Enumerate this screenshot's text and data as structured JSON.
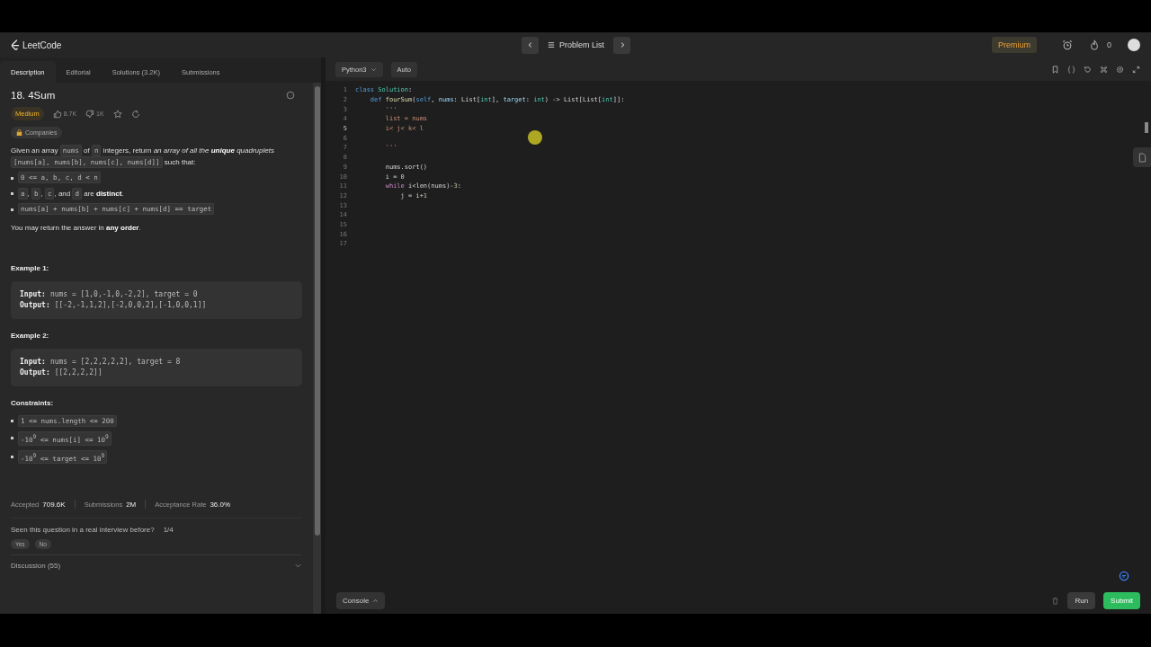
{
  "nav": {
    "logo": "LeetCode",
    "center": "Problem List",
    "premium": "Premium",
    "streak": "0"
  },
  "tabs": [
    {
      "label": "Description",
      "selected": true
    },
    {
      "label": "Editorial",
      "selected": false
    },
    {
      "label": "Solutions (3.2K)",
      "selected": false
    },
    {
      "label": "Submissions",
      "selected": false
    }
  ],
  "problem": {
    "title": "18. 4Sum",
    "difficulty": "Medium",
    "likes": "8.7K",
    "dislikes": "1K",
    "companies": "Companies",
    "intro": [
      {
        "kind": "text",
        "text": "Given an array "
      },
      {
        "kind": "code",
        "text": "nums"
      },
      {
        "kind": "text",
        "text": " of "
      },
      {
        "kind": "code",
        "text": "n"
      },
      {
        "kind": "text",
        "text": " integers, return "
      },
      {
        "kind": "italic",
        "text": "an array of all the "
      },
      {
        "kind": "bolditalic",
        "text": "unique"
      },
      {
        "kind": "italic",
        "text": " quadruplets "
      },
      {
        "kind": "code",
        "text": "[nums[a], nums[b], nums[c], nums[d]]"
      },
      {
        "kind": "text",
        "text": " such that:"
      }
    ],
    "bullets": [
      [
        {
          "kind": "code",
          "text": "0 <= a, b, c, d < n"
        }
      ],
      [
        {
          "kind": "code",
          "text": "a"
        },
        {
          "kind": "text",
          "text": ", "
        },
        {
          "kind": "code",
          "text": "b"
        },
        {
          "kind": "text",
          "text": ", "
        },
        {
          "kind": "code",
          "text": "c"
        },
        {
          "kind": "text",
          "text": ", and "
        },
        {
          "kind": "code",
          "text": "d"
        },
        {
          "kind": "text",
          "text": " are "
        },
        {
          "kind": "bold",
          "text": "distinct"
        },
        {
          "kind": "text",
          "text": "."
        }
      ],
      [
        {
          "kind": "code",
          "text": "nums[a] + nums[b] + nums[c] + nums[d] == target"
        }
      ]
    ],
    "closing": [
      {
        "kind": "text",
        "text": "You may return the answer in "
      },
      {
        "kind": "bold",
        "text": "any order"
      },
      {
        "kind": "text",
        "text": "."
      }
    ],
    "examples": [
      {
        "title": "Example 1:",
        "input_label": "Input:",
        "input": "nums = [1,0,-1,0,-2,2], target = 0",
        "output_label": "Output:",
        "output": "[[-2,-1,1,2],[-2,0,0,2],[-1,0,0,1]]"
      },
      {
        "title": "Example 2:",
        "input_label": "Input:",
        "input": "nums = [2,2,2,2,2], target = 8",
        "output_label": "Output:",
        "output": "[[2,2,2,2]]"
      }
    ],
    "constraints_title": "Constraints:",
    "constraints": [
      "1 <= nums.length <= 200",
      "-10$^{9}$ <= nums[i] <= 10$^{9}$",
      "-10$^{9}$ <= target <= 10$^{9}$"
    ],
    "stats": [
      {
        "label": "Accepted",
        "value": "709.6K"
      },
      {
        "label": "Submissions",
        "value": "2M"
      },
      {
        "label": "Acceptance Rate",
        "value": "36.0%"
      }
    ],
    "interview": {
      "question": "Seen this question in a real interview before?",
      "count": "1/4",
      "answers": [
        "Yes",
        "No"
      ]
    },
    "discussion": "Discussion (55)"
  },
  "editor": {
    "language": "Python3",
    "mode": "Auto",
    "console": "Console",
    "run": "Run",
    "submit": "Submit",
    "lines": [
      {
        "number": "1",
        "tokens": [
          {
            "kind": "keyword",
            "text": "class "
          },
          {
            "kind": "type",
            "text": "Solution"
          },
          {
            "kind": "plain",
            "text": ":"
          }
        ]
      },
      {
        "number": "2",
        "tokens": [
          {
            "kind": "keyword",
            "text": "    def "
          },
          {
            "kind": "func",
            "text": "fourSum"
          },
          {
            "kind": "plain",
            "text": "("
          },
          {
            "kind": "keyword",
            "text": "self"
          },
          {
            "kind": "plain",
            "text": ", "
          },
          {
            "kind": "param",
            "text": "nums"
          },
          {
            "kind": "plain",
            "text": ": List["
          },
          {
            "kind": "type",
            "text": "int"
          },
          {
            "kind": "plain",
            "text": "], "
          },
          {
            "kind": "param",
            "text": "target"
          },
          {
            "kind": "plain",
            "text": ": "
          },
          {
            "kind": "type",
            "text": "int"
          },
          {
            "kind": "plain",
            "text": ") -> List[List["
          },
          {
            "kind": "type",
            "text": "int"
          },
          {
            "kind": "plain",
            "text": "]]:"
          }
        ]
      },
      {
        "number": "3",
        "tokens": [
          {
            "kind": "string",
            "text": "        '''"
          }
        ]
      },
      {
        "number": "4",
        "tokens": [
          {
            "kind": "string",
            "text": "        list = nums"
          }
        ]
      },
      {
        "number": "5",
        "tokens": [
          {
            "kind": "string",
            "text": "        i< j< k< l"
          }
        ]
      },
      {
        "number": "6"
      },
      {
        "number": "7",
        "tokens": [
          {
            "kind": "string",
            "text": "        '''"
          }
        ]
      },
      {
        "number": "8"
      },
      {
        "number": "9",
        "tokens": [
          {
            "kind": "plain",
            "text": "        nums.sort()"
          }
        ]
      },
      {
        "number": "10",
        "tokens": [
          {
            "kind": "plain",
            "text": "        i = "
          },
          {
            "kind": "number",
            "text": "0"
          }
        ]
      },
      {
        "number": "11",
        "tokens": [
          {
            "kind": "control",
            "text": "        while"
          },
          {
            "kind": "plain",
            "text": " i<len(nums)-"
          },
          {
            "kind": "number",
            "text": "3"
          },
          {
            "kind": "plain",
            "text": ":"
          }
        ]
      },
      {
        "number": "12",
        "tokens": [
          {
            "kind": "plain",
            "text": "            j = i+"
          },
          {
            "kind": "number",
            "text": "1"
          }
        ]
      },
      {
        "number": "13"
      },
      {
        "number": "14"
      },
      {
        "number": "15"
      },
      {
        "number": "16"
      },
      {
        "number": "17"
      }
    ]
  }
}
